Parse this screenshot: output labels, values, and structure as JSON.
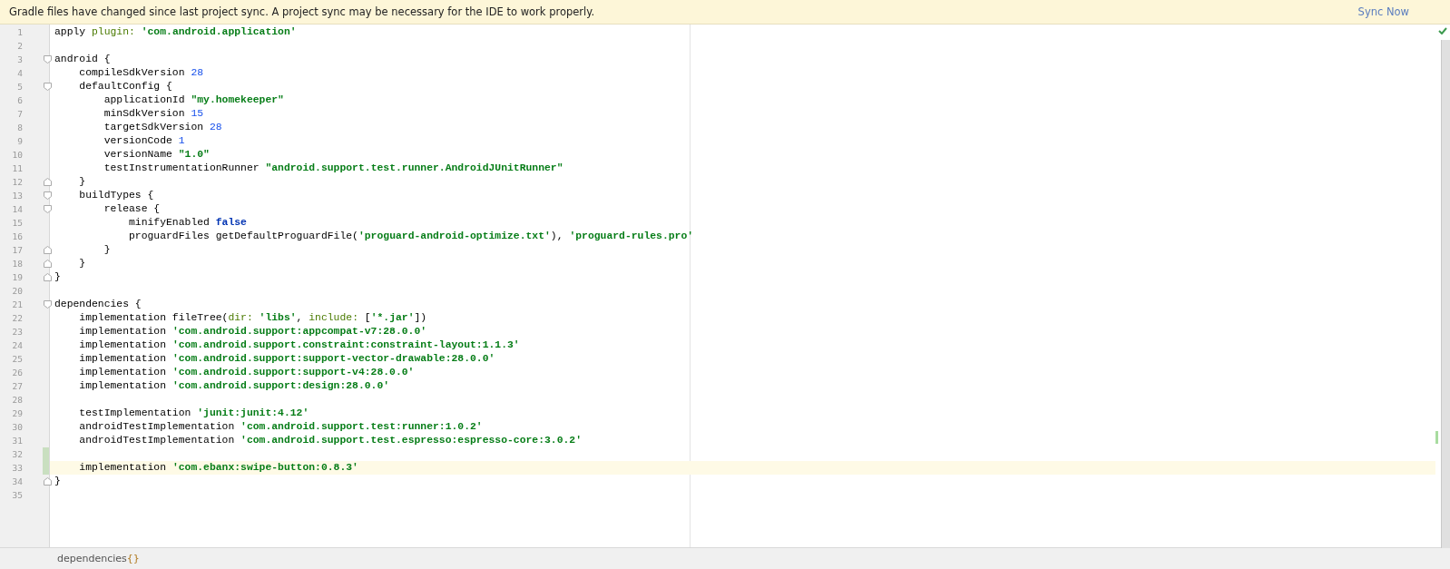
{
  "banner": {
    "message": "Gradle files have changed since last project sync. A project sync may be necessary for the IDE to work properly.",
    "action": "Sync Now"
  },
  "editor": {
    "lines": [
      {
        "number": "1",
        "kind": "code",
        "current": false,
        "changed": false,
        "tokens": [
          {
            "text": "apply ",
            "kind": "plain"
          },
          {
            "text": "plugin: ",
            "kind": "named"
          },
          {
            "text": "'com.android.application'",
            "kind": "string"
          }
        ]
      },
      {
        "number": "2",
        "kind": "code",
        "current": false,
        "changed": false
      },
      {
        "number": "3",
        "kind": "opener",
        "current": false,
        "changed": false,
        "tokens": [
          {
            "text": "android {",
            "kind": "plain"
          }
        ]
      },
      {
        "number": "4",
        "kind": "code",
        "current": false,
        "changed": false,
        "tokens": [
          {
            "text": "    compileSdkVersion ",
            "kind": "plain"
          },
          {
            "text": "28",
            "kind": "number"
          }
        ]
      },
      {
        "number": "5",
        "kind": "opener",
        "current": false,
        "changed": false,
        "tokens": [
          {
            "text": "    defaultConfig {",
            "kind": "plain"
          }
        ]
      },
      {
        "number": "6",
        "kind": "code",
        "current": false,
        "changed": false,
        "tokens": [
          {
            "text": "        applicationId ",
            "kind": "plain"
          },
          {
            "text": "\"my.homekeeper\"",
            "kind": "string"
          }
        ]
      },
      {
        "number": "7",
        "kind": "code",
        "current": false,
        "changed": false,
        "tokens": [
          {
            "text": "        minSdkVersion ",
            "kind": "plain"
          },
          {
            "text": "15",
            "kind": "number"
          }
        ]
      },
      {
        "number": "8",
        "kind": "code",
        "current": false,
        "changed": false,
        "tokens": [
          {
            "text": "        targetSdkVersion ",
            "kind": "plain"
          },
          {
            "text": "28",
            "kind": "number"
          }
        ]
      },
      {
        "number": "9",
        "kind": "code",
        "current": false,
        "changed": false,
        "tokens": [
          {
            "text": "        versionCode ",
            "kind": "plain"
          },
          {
            "text": "1",
            "kind": "number"
          }
        ]
      },
      {
        "number": "10",
        "kind": "code",
        "current": false,
        "changed": false,
        "tokens": [
          {
            "text": "        versionName ",
            "kind": "plain"
          },
          {
            "text": "\"1.0\"",
            "kind": "string"
          }
        ]
      },
      {
        "number": "11",
        "kind": "code",
        "current": false,
        "changed": false,
        "tokens": [
          {
            "text": "        testInstrumentationRunner ",
            "kind": "plain"
          },
          {
            "text": "\"android.support.test.runner.AndroidJUnitRunner\"",
            "kind": "string"
          }
        ]
      },
      {
        "number": "12",
        "kind": "closer",
        "current": false,
        "changed": false,
        "tokens": [
          {
            "text": "    }",
            "kind": "plain"
          }
        ]
      },
      {
        "number": "13",
        "kind": "opener",
        "current": false,
        "changed": false,
        "tokens": [
          {
            "text": "    buildTypes {",
            "kind": "plain"
          }
        ]
      },
      {
        "number": "14",
        "kind": "opener",
        "current": false,
        "changed": false,
        "tokens": [
          {
            "text": "        release {",
            "kind": "plain"
          }
        ]
      },
      {
        "number": "15",
        "kind": "code",
        "current": false,
        "changed": false,
        "tokens": [
          {
            "text": "            minifyEnabled ",
            "kind": "plain"
          },
          {
            "text": "false",
            "kind": "keyword"
          }
        ]
      },
      {
        "number": "16",
        "kind": "code",
        "current": false,
        "changed": false,
        "tokens": [
          {
            "text": "            proguardFiles getDefaultProguardFile(",
            "kind": "plain"
          },
          {
            "text": "'proguard-android-optimize.txt'",
            "kind": "string"
          },
          {
            "text": "), ",
            "kind": "plain"
          },
          {
            "text": "'proguard-rules.pro'",
            "kind": "string"
          }
        ]
      },
      {
        "number": "17",
        "kind": "closer",
        "current": false,
        "changed": false,
        "tokens": [
          {
            "text": "        }",
            "kind": "plain"
          }
        ]
      },
      {
        "number": "18",
        "kind": "closer",
        "current": false,
        "changed": false,
        "tokens": [
          {
            "text": "    }",
            "kind": "plain"
          }
        ]
      },
      {
        "number": "19",
        "kind": "closer",
        "current": false,
        "changed": false,
        "tokens": [
          {
            "text": "}",
            "kind": "plain"
          }
        ]
      },
      {
        "number": "20",
        "kind": "code",
        "current": false,
        "changed": false
      },
      {
        "number": "21",
        "kind": "opener",
        "current": false,
        "changed": false,
        "tokens": [
          {
            "text": "dependencies {",
            "kind": "plain"
          }
        ]
      },
      {
        "number": "22",
        "kind": "code",
        "current": false,
        "changed": false,
        "tokens": [
          {
            "text": "    implementation fileTree(",
            "kind": "plain"
          },
          {
            "text": "dir: ",
            "kind": "named"
          },
          {
            "text": "'libs'",
            "kind": "string"
          },
          {
            "text": ", ",
            "kind": "plain"
          },
          {
            "text": "include: ",
            "kind": "named"
          },
          {
            "text": "[",
            "kind": "plain"
          },
          {
            "text": "'*.jar'",
            "kind": "string"
          },
          {
            "text": "])",
            "kind": "plain"
          }
        ]
      },
      {
        "number": "23",
        "kind": "code",
        "current": false,
        "changed": false,
        "tokens": [
          {
            "text": "    implementation ",
            "kind": "plain"
          },
          {
            "text": "'com.android.support:appcompat-v7:28.0.0'",
            "kind": "string"
          }
        ]
      },
      {
        "number": "24",
        "kind": "code",
        "current": false,
        "changed": false,
        "tokens": [
          {
            "text": "    implementation ",
            "kind": "plain"
          },
          {
            "text": "'com.android.support.constraint:constraint-layout:1.1.3'",
            "kind": "string"
          }
        ]
      },
      {
        "number": "25",
        "kind": "code",
        "current": false,
        "changed": false,
        "tokens": [
          {
            "text": "    implementation ",
            "kind": "plain"
          },
          {
            "text": "'com.android.support:support-vector-drawable:28.0.0'",
            "kind": "string"
          }
        ]
      },
      {
        "number": "26",
        "kind": "code",
        "current": false,
        "changed": false,
        "tokens": [
          {
            "text": "    implementation ",
            "kind": "plain"
          },
          {
            "text": "'com.android.support:support-v4:28.0.0'",
            "kind": "string"
          }
        ]
      },
      {
        "number": "27",
        "kind": "code",
        "current": false,
        "changed": false,
        "tokens": [
          {
            "text": "    implementation ",
            "kind": "plain"
          },
          {
            "text": "'com.android.support:design:28.0.0'",
            "kind": "string"
          }
        ]
      },
      {
        "number": "28",
        "kind": "code",
        "current": false,
        "changed": false
      },
      {
        "number": "29",
        "kind": "code",
        "current": false,
        "changed": false,
        "tokens": [
          {
            "text": "    testImplementation ",
            "kind": "plain"
          },
          {
            "text": "'junit:junit:4.12'",
            "kind": "string"
          }
        ]
      },
      {
        "number": "30",
        "kind": "code",
        "current": false,
        "changed": false,
        "tokens": [
          {
            "text": "    androidTestImplementation ",
            "kind": "plain"
          },
          {
            "text": "'com.android.support.test:runner:1.0.2'",
            "kind": "string"
          }
        ]
      },
      {
        "number": "31",
        "kind": "code",
        "current": false,
        "changed": false,
        "tokens": [
          {
            "text": "    androidTestImplementation ",
            "kind": "plain"
          },
          {
            "text": "'com.android.support.test.espresso:espresso-core:3.0.2'",
            "kind": "string"
          }
        ]
      },
      {
        "number": "32",
        "kind": "code",
        "current": false,
        "changed": true
      },
      {
        "number": "33",
        "kind": "code",
        "current": true,
        "changed": true,
        "tokens": [
          {
            "text": "    implementation ",
            "kind": "plain"
          },
          {
            "text": "'com.ebanx:swipe-button:0.8.3'",
            "kind": "string"
          }
        ]
      },
      {
        "number": "34",
        "kind": "closer",
        "current": false,
        "changed": false,
        "tokens": [
          {
            "text": "}",
            "kind": "plain"
          }
        ]
      },
      {
        "number": "35",
        "kind": "code",
        "current": false,
        "changed": false
      }
    ]
  },
  "breadcrumb": {
    "name": "dependencies",
    "braces": "{}"
  }
}
